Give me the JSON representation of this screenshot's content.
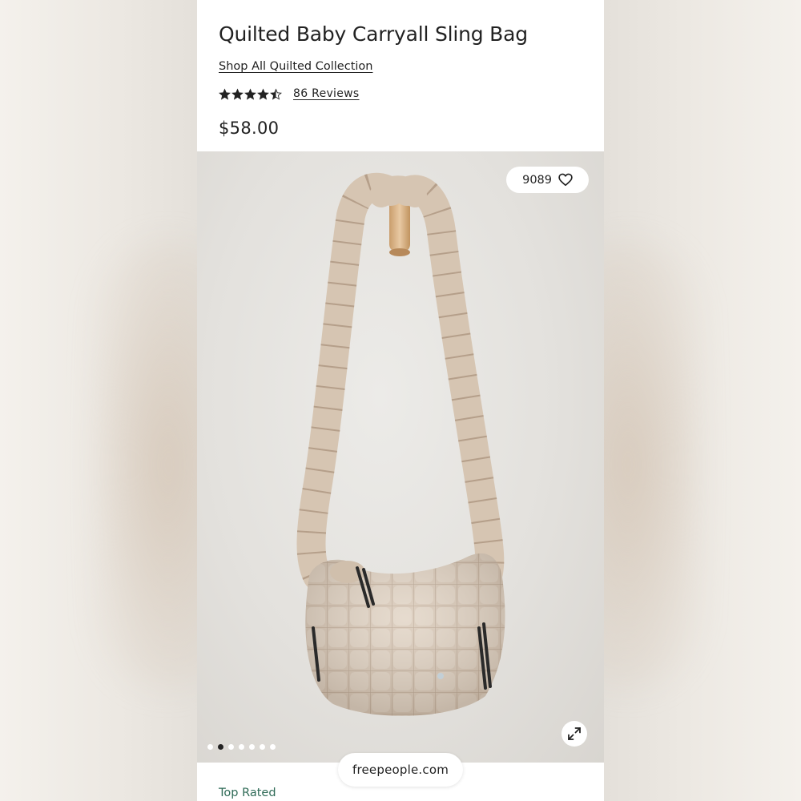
{
  "product": {
    "title": "Quilted Baby Carryall Sling Bag",
    "collection_link": "Shop All Quilted Collection",
    "rating": 4.5,
    "rating_max": 5,
    "reviews_label": "86 Reviews",
    "price": "$58.00"
  },
  "gallery": {
    "favorites_count": "9089",
    "image_count": 7,
    "active_index": 1
  },
  "section_label": "Top Rated",
  "watermark": "freepeople.com",
  "colors": {
    "accent_green": "#2f6b57",
    "text": "#222222",
    "bag": "#d9c9b8",
    "wall": "#e2e0dc"
  }
}
